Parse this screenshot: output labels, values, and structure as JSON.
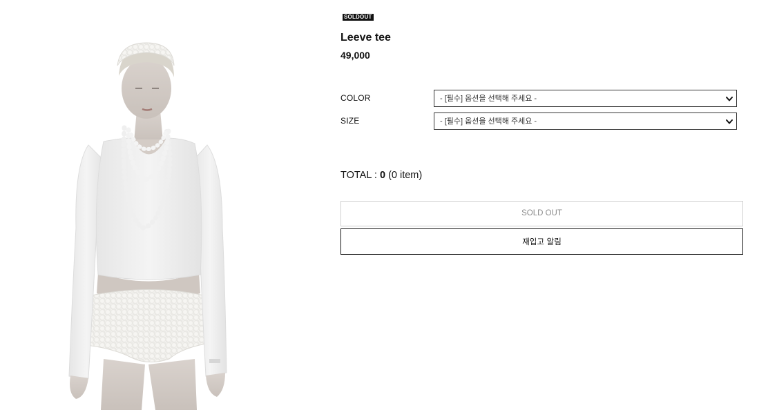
{
  "product": {
    "image": {
      "description_icon": "product-model-photo"
    },
    "badge": "SOLDOUT",
    "name": "Leeve tee",
    "price": "49,000"
  },
  "options": [
    {
      "label": "COLOR",
      "placeholder": "- [필수] 옵션을 선택해 주세요 -"
    },
    {
      "label": "SIZE",
      "placeholder": "- [필수] 옵션을 선택해 주세요 -"
    }
  ],
  "total": {
    "prefix": "TOTAL : ",
    "amount": "0",
    "count": "(0 item)"
  },
  "buttons": {
    "soldout": "SOLD OUT",
    "restock": "재입고 알림"
  },
  "icons": {
    "select_arrow": "chevron-down-icon"
  },
  "colors": {
    "badge_bg": "#111111",
    "text": "#111111",
    "soldout_text": "#8a8a8a",
    "soldout_border": "#cfcfcf"
  }
}
